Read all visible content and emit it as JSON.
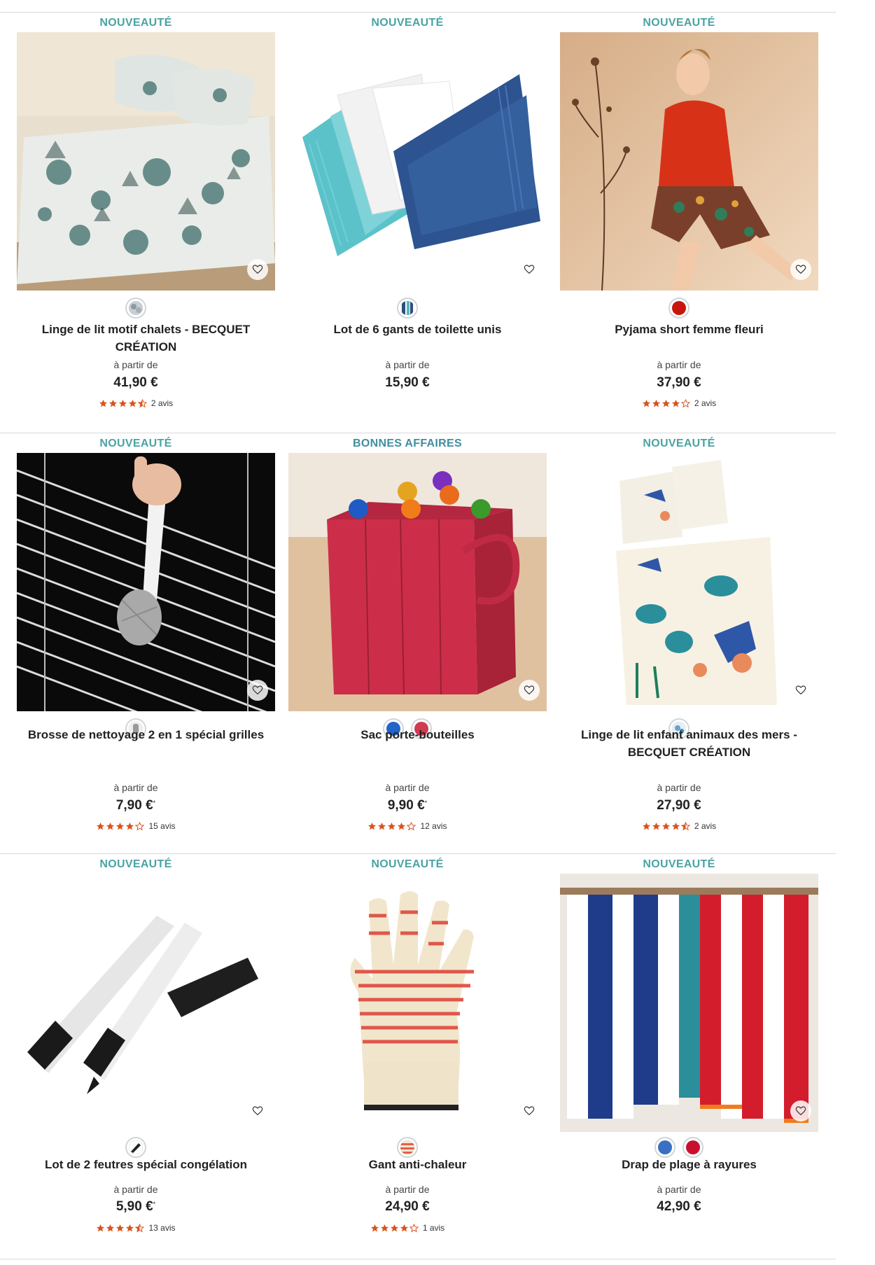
{
  "accent_color": "#4aa3a3",
  "star_color": "#d9531e",
  "favorite_icon": "heart-outline-icon",
  "products": [
    {
      "badge": "NOUVEAUTÉ",
      "image": "bedding-chalets-photo",
      "swatches": [
        {
          "name": "floral-grey",
          "color": "#b7c0c6"
        }
      ],
      "title": "Linge de lit motif chalets - BECQUET CRÉATION",
      "from_label": "à partir de",
      "price": "41,90 €",
      "price_note": "",
      "rating": 4.5,
      "reviews": "2 avis"
    },
    {
      "badge": "NOUVEAUTÉ",
      "image": "washcloths-photo",
      "swatches": [
        {
          "name": "multicolor-stripes",
          "color": "#2d4f7a"
        }
      ],
      "title": "Lot de 6 gants de toilette unis",
      "from_label": "à partir de",
      "price": "15,90 €",
      "price_note": "",
      "rating": null,
      "reviews": ""
    },
    {
      "badge": "NOUVEAUTÉ",
      "image": "pyjama-woman-photo",
      "swatches": [
        {
          "name": "red",
          "color": "#c8160e"
        }
      ],
      "title": "Pyjama short femme fleuri",
      "from_label": "à partir de",
      "price": "37,90 €",
      "price_note": "",
      "rating": 4,
      "reviews": "2 avis"
    },
    {
      "badge": "NOUVEAUTÉ",
      "image": "grill-brush-photo",
      "swatches": [
        {
          "name": "grey-brush",
          "color": "#9a9a9a"
        }
      ],
      "title": "Brosse de nettoyage 2 en 1 spécial grilles",
      "from_label": "à partir de",
      "price": "7,90 €",
      "price_note": "*",
      "rating": 4,
      "reviews": "15 avis"
    },
    {
      "badge": "BONNES AFFAIRES",
      "image": "bottle-bag-photo",
      "swatches": [
        {
          "name": "blue",
          "color": "#2464c9"
        },
        {
          "name": "red",
          "color": "#d23a52"
        }
      ],
      "title": "Sac porte-bouteilles",
      "from_label": "à partir de",
      "price": "9,90 €",
      "price_note": "*",
      "rating": 4,
      "reviews": "12 avis"
    },
    {
      "badge": "NOUVEAUTÉ",
      "image": "kids-sea-bedding-photo",
      "swatches": [
        {
          "name": "sea-print",
          "color": "#6f9fc9"
        }
      ],
      "title": "Linge de lit enfant animaux des mers - BECQUET CRÉATION",
      "from_label": "à partir de",
      "price": "27,90 €",
      "price_note": "",
      "rating": 4.5,
      "reviews": "2 avis"
    },
    {
      "badge": "NOUVEAUTÉ",
      "image": "freezer-markers-photo",
      "swatches": [
        {
          "name": "black",
          "color": "#222222"
        }
      ],
      "title": "Lot de 2 feutres spécial congélation",
      "from_label": "à partir de",
      "price": "5,90 €",
      "price_note": "*",
      "rating": 4.5,
      "reviews": "13 avis"
    },
    {
      "badge": "NOUVEAUTÉ",
      "image": "oven-glove-photo",
      "swatches": [
        {
          "name": "red-stripes",
          "color": "#e2614c"
        }
      ],
      "title": "Gant anti-chaleur",
      "from_label": "à partir de",
      "price": "24,90 €",
      "price_note": "",
      "rating": 4,
      "reviews": "1 avis"
    },
    {
      "badge": "NOUVEAUTÉ",
      "image": "beach-towel-stripes-photo",
      "swatches": [
        {
          "name": "blue",
          "color": "#3b6fc4"
        },
        {
          "name": "red",
          "color": "#c8102e"
        }
      ],
      "title": "Drap de plage à rayures",
      "from_label": "à partir de",
      "price": "42,90 €",
      "price_note": "",
      "rating": null,
      "reviews": ""
    }
  ]
}
